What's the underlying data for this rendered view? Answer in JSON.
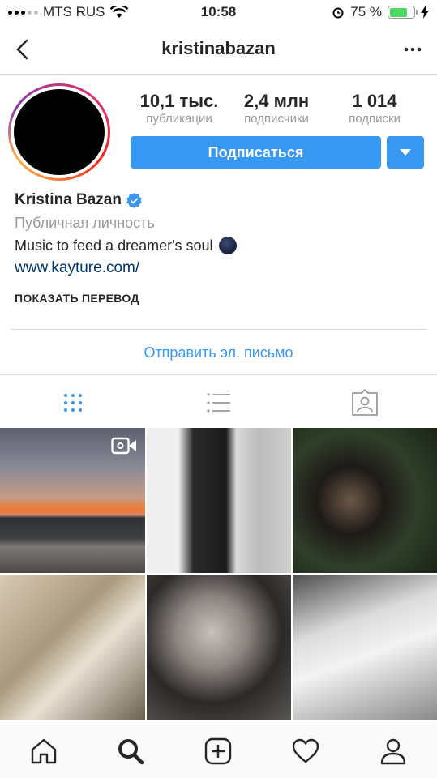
{
  "status_bar": {
    "carrier": "MTS RUS",
    "time": "10:58",
    "battery": "75 %",
    "battery_level": 0.75
  },
  "header": {
    "username": "kristinabazan"
  },
  "stats": [
    {
      "value": "10,1 тыс.",
      "label": "публикации"
    },
    {
      "value": "2,4 млн",
      "label": "подписчики"
    },
    {
      "value": "1 014",
      "label": "подписки"
    }
  ],
  "actions": {
    "follow_label": "Подписаться"
  },
  "profile": {
    "name": "Kristina Bazan",
    "category": "Публичная личность",
    "bio": "Music to feed a dreamer's soul",
    "link": "www.kayture.com/",
    "translate_label": "ПОКАЗАТЬ ПЕРЕВОД",
    "email_label": "Отправить эл. письмо"
  },
  "colors": {
    "accent": "#3897f0",
    "link": "#003569",
    "verified": "#3897f0"
  },
  "icons": {
    "tabs": [
      "grid-icon",
      "list-icon",
      "tagged-icon"
    ],
    "nav": [
      "home-icon",
      "search-icon",
      "add-post-icon",
      "heart-icon",
      "profile-icon"
    ]
  }
}
